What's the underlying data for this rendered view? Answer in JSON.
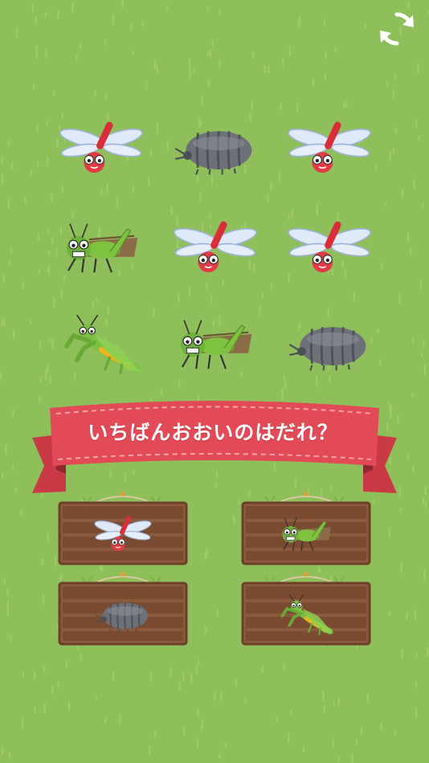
{
  "game": {
    "prompt": "いちばんおおいのはだれ？",
    "reload_icon": "reload-icon"
  },
  "grid": {
    "rows": [
      [
        "dragonfly",
        "pillbug",
        "dragonfly"
      ],
      [
        "grasshopper",
        "dragonfly",
        "dragonfly"
      ],
      [
        "mantis",
        "grasshopper",
        "pillbug"
      ]
    ]
  },
  "answers": [
    {
      "insect": "dragonfly"
    },
    {
      "insect": "grasshopper"
    },
    {
      "insect": "pillbug"
    },
    {
      "insect": "mantis"
    }
  ],
  "colors": {
    "grass": "#8fbf5a",
    "grass_dark": "#7fb04e",
    "ribbon": "#e34a57",
    "ribbon_dark": "#b8323d",
    "board": "#8b5a3c",
    "board_line": "#6b4029"
  }
}
